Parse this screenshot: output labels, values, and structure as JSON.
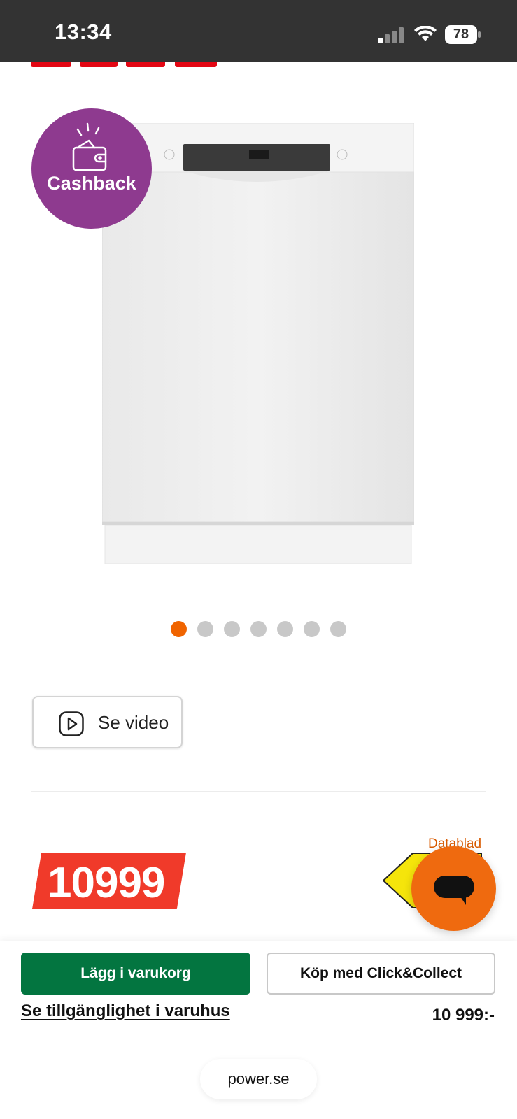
{
  "status_bar": {
    "time": "13:34",
    "battery": "78",
    "icons": [
      "cellular-signal-icon",
      "wifi-icon",
      "battery-icon"
    ]
  },
  "product": {
    "badge_label": "Cashback",
    "image_count": 7,
    "active_image_index": 0
  },
  "video": {
    "label": "Se video"
  },
  "price": {
    "tag_value": "10999",
    "formatted": "10 999:-"
  },
  "energy": {
    "datablad_label": "Datablad"
  },
  "actions": {
    "add_to_cart": "Lägg i varukorg",
    "click_collect": "Köp med Click&Collect",
    "availability": "Se tillgänglighet i varuhus"
  },
  "browser": {
    "url": "power.se"
  },
  "colors": {
    "status_bar": "#333333",
    "brand_red": "#e30613",
    "cashback_purple": "#8e3a8f",
    "dot_active": "#f06400",
    "price_tag": "#f03a2a",
    "chat_orange": "#ef6a0f",
    "cart_green": "#037540"
  }
}
